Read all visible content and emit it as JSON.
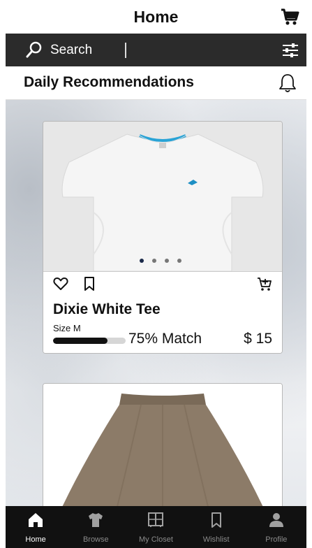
{
  "header": {
    "title": "Home",
    "cart_icon": "cart-icon"
  },
  "search": {
    "placeholder": "Search",
    "search_icon": "search-icon",
    "filter_icon": "filter-sliders-icon"
  },
  "recommendations": {
    "label": "Daily Recommendations",
    "bell_icon": "bell-icon"
  },
  "products": [
    {
      "name": "Dixie White Tee",
      "size": "Size M",
      "match_text": "75% Match",
      "match_fraction": 0.75,
      "price": "$ 15",
      "image_dots": 4,
      "active_dot": 0
    },
    {
      "image": "skirt"
    }
  ],
  "nav": {
    "items": [
      {
        "label": "Home",
        "icon": "home-icon",
        "active": true
      },
      {
        "label": "Browse",
        "icon": "shirt-icon",
        "active": false
      },
      {
        "label": "My Closet",
        "icon": "closet-icon",
        "active": false
      },
      {
        "label": "Wishlist",
        "icon": "bookmark-icon",
        "active": false
      },
      {
        "label": "Profile",
        "icon": "person-icon",
        "active": false
      }
    ]
  },
  "colors": {
    "header_bg": "#ffffff",
    "search_bg": "#2b2b2b",
    "nav_bg": "#111111",
    "accent_dot": "#1b2a4a"
  }
}
